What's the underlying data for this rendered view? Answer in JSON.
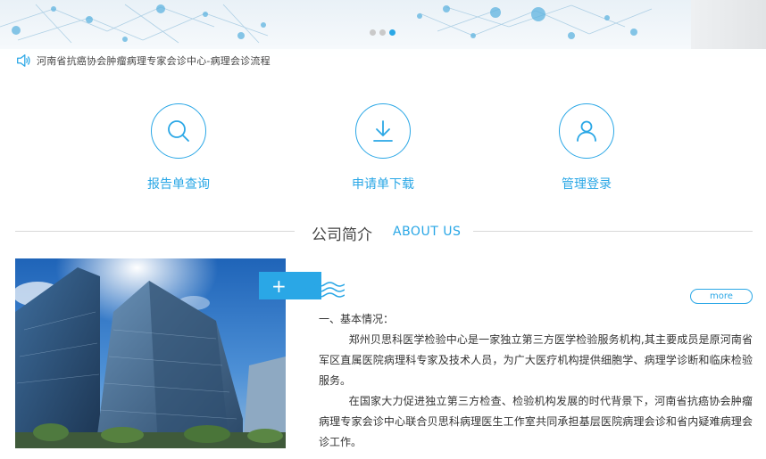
{
  "banner": {
    "notice_text": "河南省抗癌协会肿瘤病理专家会诊中心-病理会诊流程",
    "slide_count": 3,
    "active_slide": 3
  },
  "quick_links": [
    {
      "label": "报告单查询",
      "icon": "search-icon"
    },
    {
      "label": "申请单下载",
      "icon": "download-icon"
    },
    {
      "label": "管理登录",
      "icon": "user-icon"
    }
  ],
  "about": {
    "title": "公司简介",
    "subtitle": "ABOUT US",
    "plus": "+",
    "more": "more",
    "heading": "一、基本情况：",
    "para1": "郑州贝思科医学检验中心是一家独立第三方医学检验服务机构,其主要成员是原河南省军区直属医院病理科专家及技术人员，为广大医疗机构提供细胞学、病理学诊断和临床检验服务。",
    "para2": "在国家大力促进独立第三方检查、检验机构发展的时代背景下，河南省抗癌协会肿瘤病理专家会诊中心联合贝思科病理医生工作室共同承担基层医院病理会诊和省内疑难病理会诊工作。"
  },
  "colors": {
    "accent": "#2aa7e6",
    "text": "#333333",
    "divider": "#d8d8d8"
  }
}
